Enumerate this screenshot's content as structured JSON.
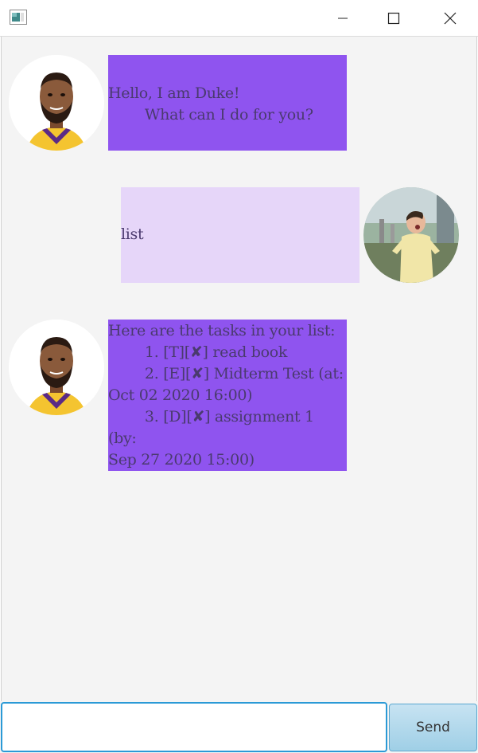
{
  "window": {
    "icons": {
      "app": "app-icon",
      "minimize": "minimize-icon",
      "maximize": "maximize-icon",
      "close": "close-icon"
    }
  },
  "chat": {
    "messages": [
      {
        "sender": "duke",
        "text": "Hello, I am Duke!\n        What can I do for you?"
      },
      {
        "sender": "user",
        "text": "list"
      },
      {
        "sender": "duke",
        "text": "Here are the tasks in your list:\n        1. [T][✘] read book\n        2. [E][✘] Midterm Test (at:\nOct 02 2020 16:00)\n        3. [D][✘] assignment 1 (by:\nSep 27 2020 15:00)"
      }
    ]
  },
  "input": {
    "value": "",
    "placeholder": ""
  },
  "send_button": {
    "label": "Send"
  },
  "colors": {
    "duke_bubble": "#8f54ef",
    "user_bubble": "#e6d6f9",
    "chat_background": "#f4f4f4"
  }
}
